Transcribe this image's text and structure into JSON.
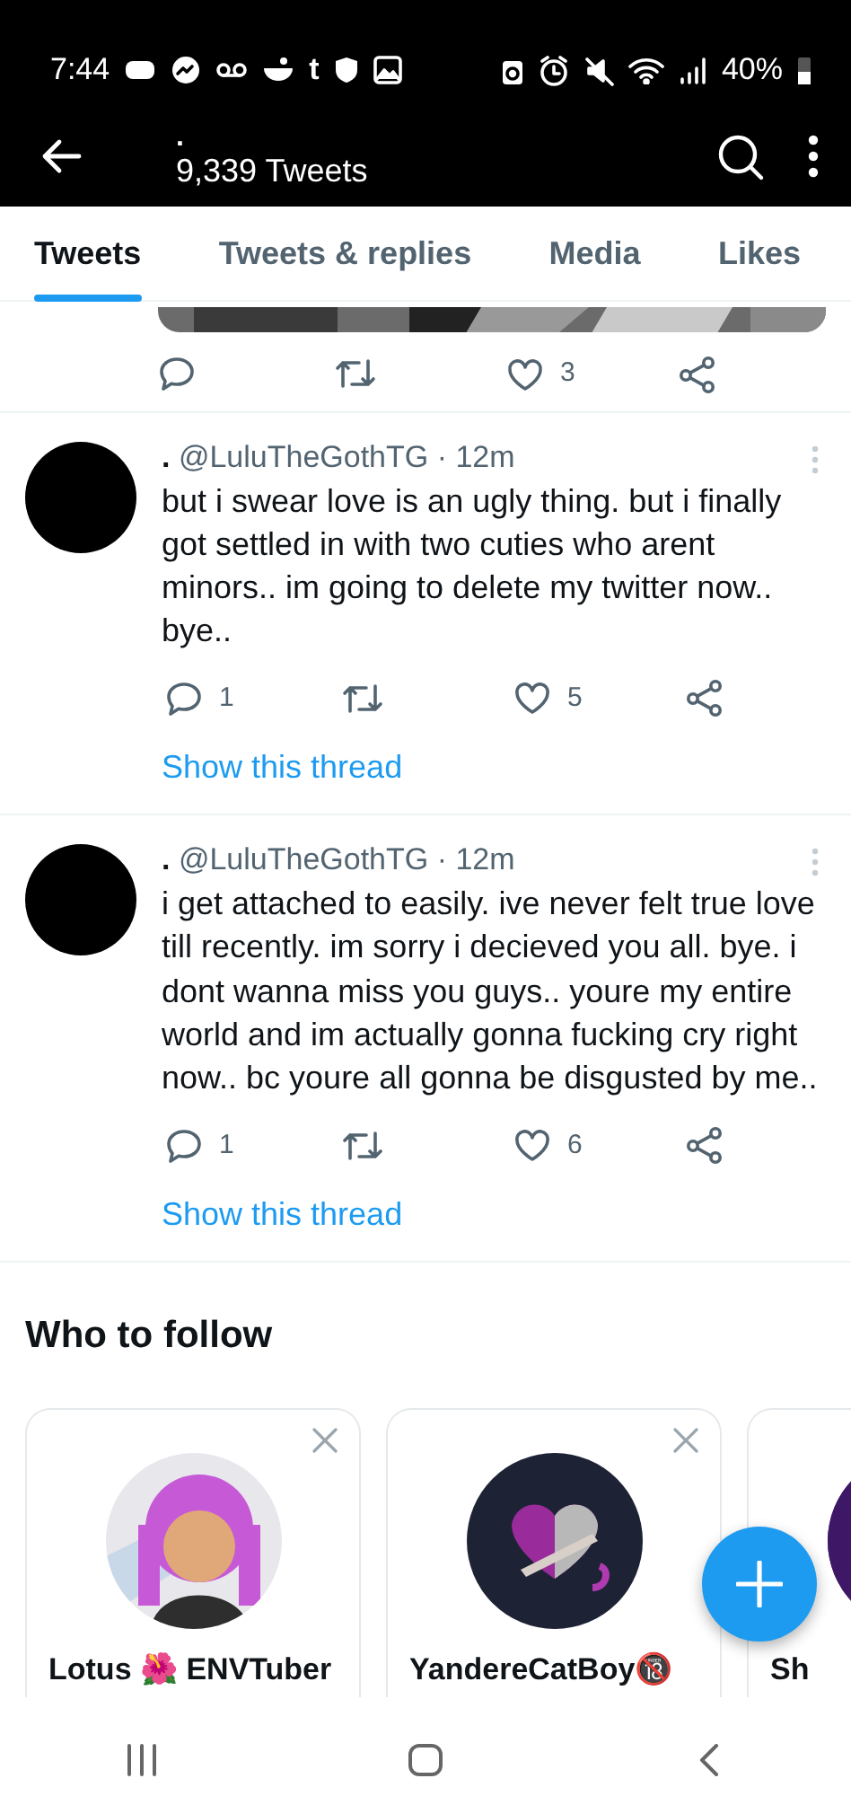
{
  "status_bar": {
    "time": "7:44",
    "tumblr": "t",
    "battery": "40%"
  },
  "header": {
    "title": ".",
    "subtitle": "9,339 Tweets"
  },
  "tabs": [
    {
      "label": "Tweets",
      "selected": true
    },
    {
      "label": "Tweets & replies",
      "selected": false
    },
    {
      "label": "Media",
      "selected": false
    },
    {
      "label": "Likes",
      "selected": false
    }
  ],
  "previous_tweet": {
    "actions": [
      {
        "kind": "reply"
      },
      {
        "kind": "retweet"
      },
      {
        "kind": "like",
        "count": "3"
      },
      {
        "kind": "share"
      }
    ]
  },
  "tweets": [
    {
      "name": ".",
      "handle": "@LuluTheGothTG",
      "separator": "·",
      "time": "12m",
      "text": "but i swear love is an ugly thing. but i finally got settled in with two cuties who arent minors.. im going to delete my twitter now.. bye..",
      "actions": [
        {
          "kind": "reply",
          "count": "1"
        },
        {
          "kind": "retweet"
        },
        {
          "kind": "like",
          "count": "5"
        },
        {
          "kind": "share"
        }
      ],
      "thread_link": "Show this thread"
    },
    {
      "name": ".",
      "handle": "@LuluTheGothTG",
      "separator": "·",
      "time": "12m",
      "text": "i get attached to easily. ive never felt true love till recently. im sorry i decieved you all. bye. i dont wanna miss you guys.. youre my entire world and im actually gonna fucking cry right now.. bc youre all gonna be disgusted by me..",
      "actions": [
        {
          "kind": "reply",
          "count": "1"
        },
        {
          "kind": "retweet"
        },
        {
          "kind": "like",
          "count": "6"
        },
        {
          "kind": "share"
        }
      ],
      "thread_link": "Show this thread"
    }
  ],
  "who_to_follow": {
    "title": "Who to follow",
    "cards": [
      {
        "name": "Lotus 🌺 ENVTuber",
        "dismissible": true
      },
      {
        "name": "YandereCatBoy🔞",
        "dismissible": true
      },
      {
        "name": "Sh",
        "dismissible": false
      }
    ]
  }
}
